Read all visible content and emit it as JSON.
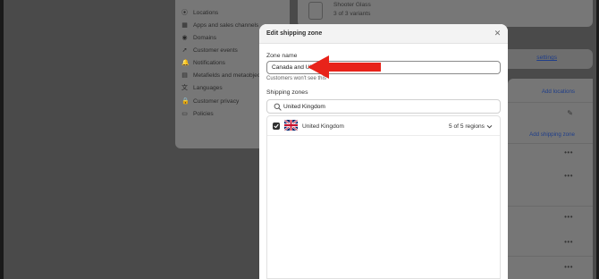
{
  "background": {
    "sidebar": {
      "items": [
        {
          "label": "Locations",
          "icon": "location-pin-icon",
          "glyph": "⦿"
        },
        {
          "label": "Apps and sales channels",
          "icon": "apps-icon",
          "glyph": "▦"
        },
        {
          "label": "Domains",
          "icon": "globe-icon",
          "glyph": "◉"
        },
        {
          "label": "Customer events",
          "icon": "cursor-icon",
          "glyph": "➚"
        },
        {
          "label": "Notifications",
          "icon": "bell-icon",
          "glyph": "🔔"
        },
        {
          "label": "Metafields and metaobjects",
          "icon": "metafields-icon",
          "glyph": "▤"
        },
        {
          "label": "Languages",
          "icon": "language-icon",
          "glyph": "文"
        },
        {
          "label": "Customer privacy",
          "icon": "lock-icon",
          "glyph": "🔒"
        },
        {
          "label": "Policies",
          "icon": "document-icon",
          "glyph": "▭"
        }
      ]
    },
    "product_card": {
      "title": "Shooter Glass",
      "variants": "3 of 3 variants"
    },
    "settings_link": "settings",
    "right_card": {
      "add_locations": "Add locations",
      "add_shipping_zone": "Add shipping zone",
      "more_glyph": "•••"
    }
  },
  "modal": {
    "title": "Edit shipping zone",
    "close_glyph": "✕",
    "zone_name_label": "Zone name",
    "zone_name_value": "Canada and UK",
    "help_text": "Customers won't see this",
    "shipping_zones_label": "Shipping zones",
    "search_value": "United Kingdom",
    "zones": [
      {
        "country": "United Kingdom",
        "regions": "5 of 5 regions",
        "checked": true,
        "flag": "uk-flag"
      }
    ]
  },
  "annotation": {
    "arrow_color": "#e8231a"
  },
  "colors": {
    "link": "#005bd3",
    "checkbox": "#303030"
  }
}
